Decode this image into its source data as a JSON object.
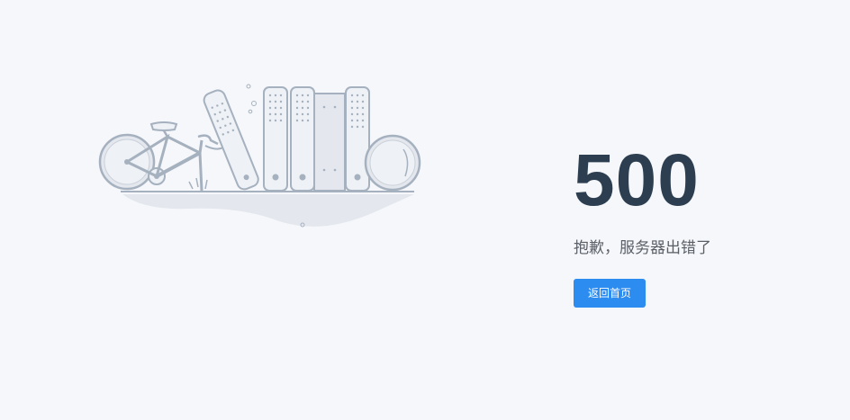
{
  "error": {
    "code": "500",
    "message": "抱歉，服务器出错了",
    "home_button_label": "返回首页"
  },
  "colors": {
    "background": "#f5f7fa",
    "code_text": "#2c3e50",
    "message_text": "#5a5e66",
    "button_bg": "#2d8cf0",
    "illustration_stroke": "#a6b1bf",
    "illustration_fill": "#e4e8ee"
  },
  "illustration": {
    "icon": "broken-bicycle-and-bookshelf-illustration"
  }
}
